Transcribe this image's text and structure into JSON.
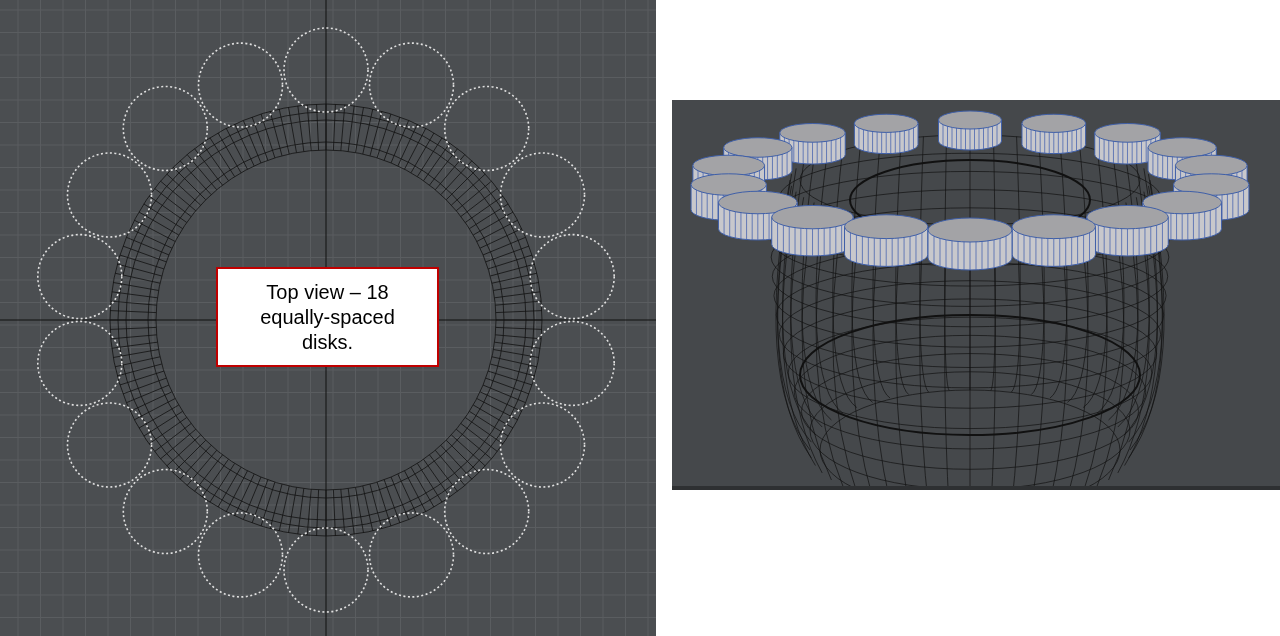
{
  "callout": {
    "text": "Top view – 18 equally-spaced disks."
  }
}
